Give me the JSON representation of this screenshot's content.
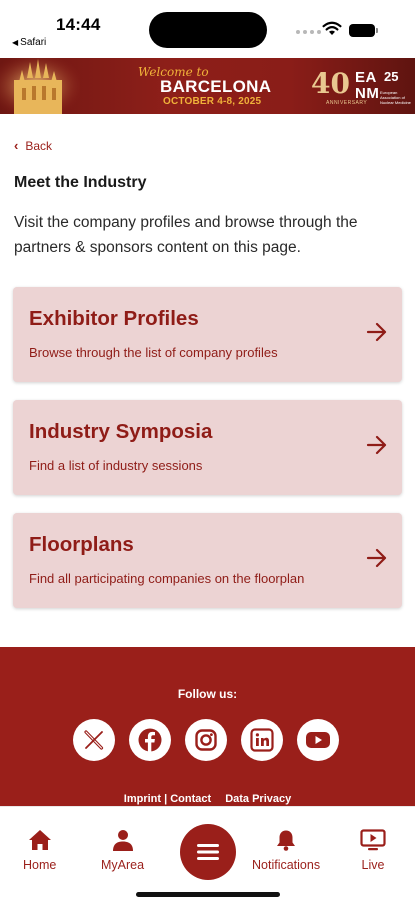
{
  "status_bar": {
    "time": "14:44",
    "back_app": "Safari"
  },
  "banner": {
    "welcome": "Welcome to",
    "city": "BARCELONA",
    "dates": "OCTOBER 4-8, 2025",
    "forty": "40",
    "forty_sub": "ANNIVERSARY",
    "org_top": "EA",
    "org_bottom": "NM",
    "year": "25",
    "org_sub": "European Association of Nuclear Medicine"
  },
  "nav": {
    "back_label": "Back"
  },
  "page": {
    "title": "Meet the Industry",
    "intro": "Visit the company profiles and browse through the partners & sponsors content on this page."
  },
  "cards": [
    {
      "title": "Exhibitor Profiles",
      "description": "Browse through the list of company profiles"
    },
    {
      "title": "Industry Symposia",
      "description": "Find a list of industry sessions"
    },
    {
      "title": "Floorplans",
      "description": "Find all participating companies on the floorplan"
    }
  ],
  "footer": {
    "follow_label": "Follow us:",
    "socials": [
      "x-icon",
      "facebook-icon",
      "instagram-icon",
      "linkedin-icon",
      "youtube-icon"
    ],
    "imprint_contact": "Imprint | Contact",
    "privacy": "Data Privacy"
  },
  "tabbar": {
    "home": "Home",
    "myarea": "MyArea",
    "notifications": "Notifications",
    "live": "Live"
  },
  "colors": {
    "brand": "#9a1f1a",
    "card_bg": "#ecd3d3",
    "banner_gold": "#f0b23a"
  }
}
